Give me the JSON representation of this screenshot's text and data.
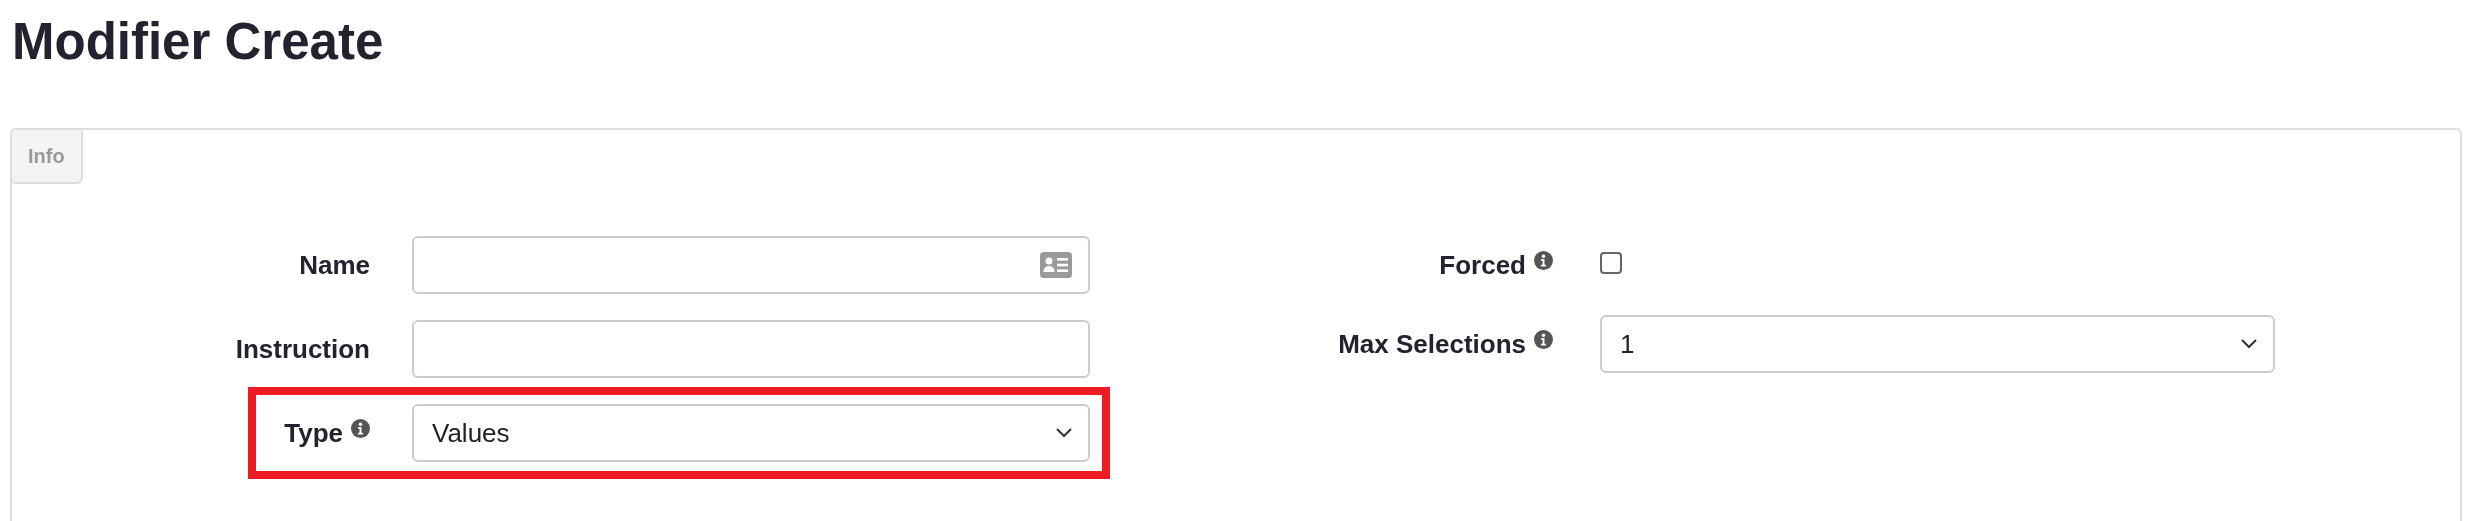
{
  "page": {
    "title": "Modifier Create"
  },
  "tabs": [
    {
      "label": "Info",
      "selected": true
    }
  ],
  "left_fields": [
    {
      "kind": "text-card",
      "label": "Name",
      "info": false,
      "highlighted": false
    },
    {
      "kind": "text",
      "label": "Instruction",
      "info": false,
      "highlighted": false
    },
    {
      "kind": "select",
      "label": "Type",
      "info": true,
      "highlighted": true,
      "value": "Values"
    }
  ],
  "right_fields": [
    {
      "kind": "checkbox",
      "label": "Forced",
      "info": true,
      "checked": false
    },
    {
      "kind": "select",
      "label": "Max Selections",
      "info": true,
      "value": "1"
    }
  ]
}
